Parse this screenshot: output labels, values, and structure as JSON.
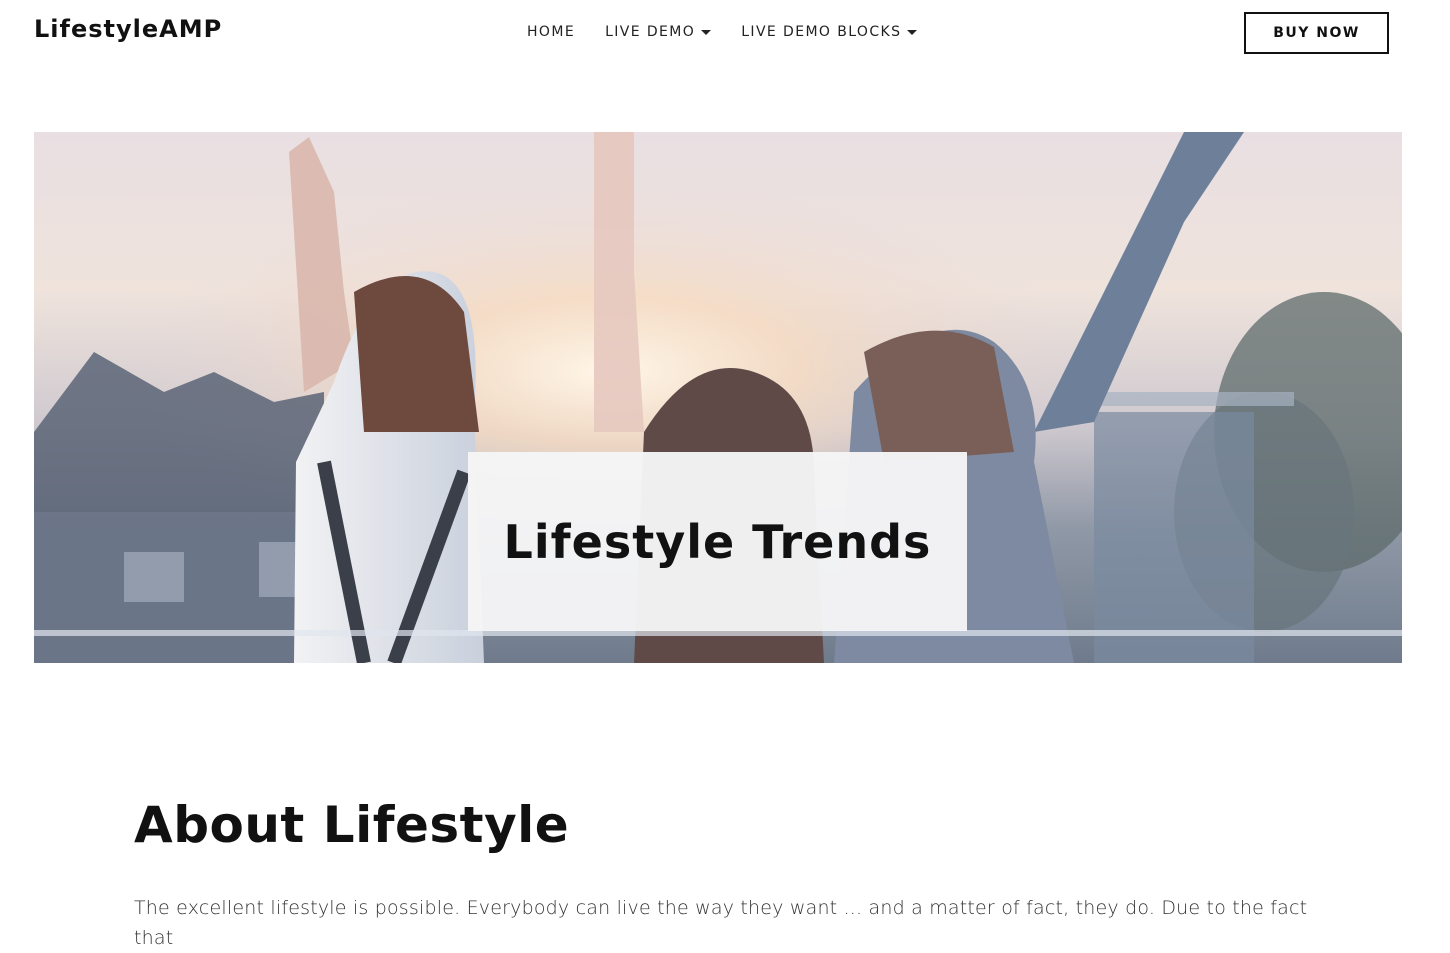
{
  "header": {
    "logo": "LifestyleAMP",
    "nav": [
      {
        "label": "HOME",
        "dropdown": false
      },
      {
        "label": "LIVE DEMO",
        "dropdown": true
      },
      {
        "label": "LIVE DEMO BLOCKS",
        "dropdown": true
      }
    ],
    "buy_label": "BUY NOW"
  },
  "hero": {
    "title": "Lifestyle Trends"
  },
  "about": {
    "title": "About Lifestyle",
    "text": "The excellent lifestyle is possible. Everybody can live the way they want ... and a matter of fact, they do. Due to the fact that"
  }
}
